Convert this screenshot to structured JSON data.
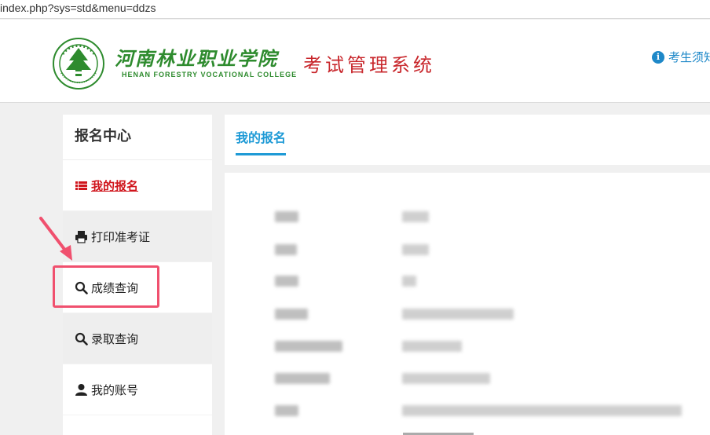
{
  "browser": {
    "url": "index.php?sys=std&menu=ddzs"
  },
  "header": {
    "college_name_cn": "河南林业职业学院",
    "college_name_en": "HENAN FORESTRY VOCATIONAL COLLEGE",
    "system_title": "考试管理系统",
    "notice_label": "考生须知"
  },
  "sidebar": {
    "title": "报名中心",
    "items": [
      {
        "label": "我的报名",
        "icon": "list-icon",
        "state": "active"
      },
      {
        "label": "打印准考证",
        "icon": "print-icon",
        "state": "shaded"
      },
      {
        "label": "成绩查询",
        "icon": "search-icon",
        "state": "highlighted"
      },
      {
        "label": "录取查询",
        "icon": "search-icon",
        "state": "shaded"
      },
      {
        "label": "我的账号",
        "icon": "user-icon",
        "state": "normal"
      }
    ]
  },
  "main": {
    "tab_label": "我的报名"
  },
  "colors": {
    "accent_blue": "#1e9ad6",
    "brand_green": "#2e8b2e",
    "title_red": "#c8262b",
    "active_red": "#d0151c",
    "annotation_pink": "#f0506e"
  }
}
